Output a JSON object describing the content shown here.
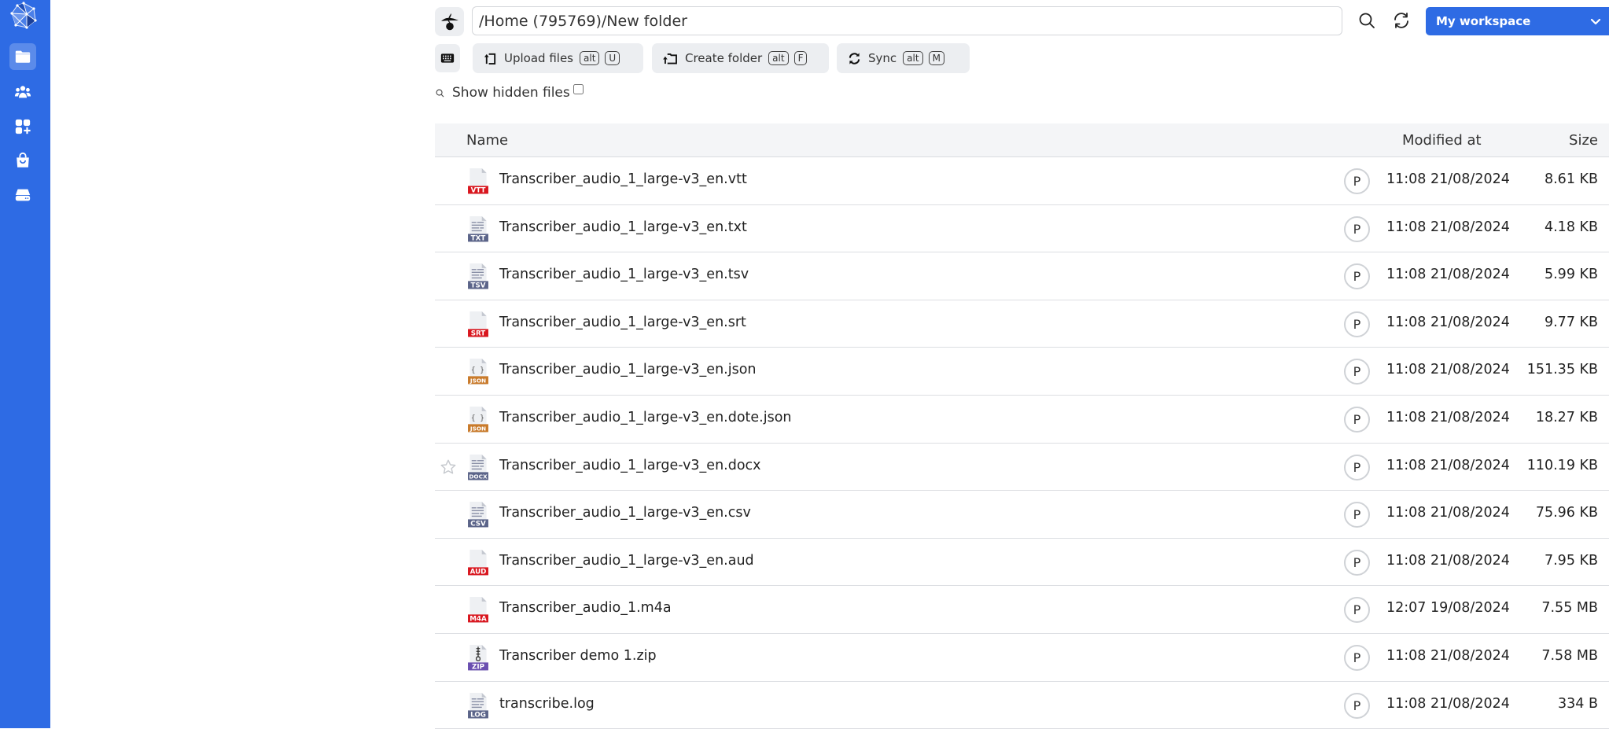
{
  "sidebar": {
    "logo": "polyhedron-logo",
    "items": [
      {
        "name": "files",
        "icon": "folder-icon",
        "active": true
      },
      {
        "name": "users",
        "icon": "users-icon",
        "active": false
      },
      {
        "name": "apps",
        "icon": "apps-add-icon",
        "active": false
      },
      {
        "name": "store",
        "icon": "shopping-bag-icon",
        "active": false
      },
      {
        "name": "storage",
        "icon": "drive-icon",
        "active": false
      }
    ]
  },
  "topbar": {
    "path": "/Home (795769)/New folder",
    "workspace_label": "My workspace",
    "accent": "#2e6be4"
  },
  "toolbar": {
    "upload": {
      "label": "Upload files",
      "keys": [
        "alt",
        "U"
      ]
    },
    "create": {
      "label": "Create folder",
      "keys": [
        "alt",
        "F"
      ]
    },
    "sync": {
      "label": "Sync",
      "keys": [
        "alt",
        "M"
      ]
    }
  },
  "filters": {
    "show_hidden_label": "Show hidden files",
    "show_hidden_checked": false
  },
  "table": {
    "columns": {
      "name": "Name",
      "modified": "Modified at",
      "size": "Size"
    },
    "rows": [
      {
        "name": "Transcriber_audio_1_large-v3_en.vtt",
        "type": "VTT",
        "color": "#d9161e",
        "style": "blank",
        "owner": "P",
        "modified": "11:08 21/08/2024",
        "size": "8.61 KB"
      },
      {
        "name": "Transcriber_audio_1_large-v3_en.txt",
        "type": "TXT",
        "color": "#5b6489",
        "style": "lines",
        "owner": "P",
        "modified": "11:08 21/08/2024",
        "size": "4.18 KB"
      },
      {
        "name": "Transcriber_audio_1_large-v3_en.tsv",
        "type": "TSV",
        "color": "#5b6489",
        "style": "lines",
        "owner": "P",
        "modified": "11:08 21/08/2024",
        "size": "5.99 KB"
      },
      {
        "name": "Transcriber_audio_1_large-v3_en.srt",
        "type": "SRT",
        "color": "#d9161e",
        "style": "blank",
        "owner": "P",
        "modified": "11:08 21/08/2024",
        "size": "9.77 KB"
      },
      {
        "name": "Transcriber_audio_1_large-v3_en.json",
        "type": "JSON",
        "color": "#c97a2a",
        "style": "braces",
        "owner": "P",
        "modified": "11:08 21/08/2024",
        "size": "151.35 KB"
      },
      {
        "name": "Transcriber_audio_1_large-v3_en.dote.json",
        "type": "JSON",
        "color": "#c97a2a",
        "style": "braces",
        "owner": "P",
        "modified": "11:08 21/08/2024",
        "size": "18.27 KB"
      },
      {
        "name": "Transcriber_audio_1_large-v3_en.docx",
        "type": "DOCX",
        "color": "#5b6489",
        "style": "lines",
        "owner": "P",
        "modified": "11:08 21/08/2024",
        "size": "110.19 KB",
        "star": true
      },
      {
        "name": "Transcriber_audio_1_large-v3_en.csv",
        "type": "CSV",
        "color": "#5b6489",
        "style": "lines",
        "owner": "P",
        "modified": "11:08 21/08/2024",
        "size": "75.96 KB"
      },
      {
        "name": "Transcriber_audio_1_large-v3_en.aud",
        "type": "AUD",
        "color": "#d9161e",
        "style": "blank",
        "owner": "P",
        "modified": "11:08 21/08/2024",
        "size": "7.95 KB"
      },
      {
        "name": "Transcriber_audio_1.m4a",
        "type": "M4A",
        "color": "#d9161e",
        "style": "blank",
        "owner": "P",
        "modified": "12:07 19/08/2024",
        "size": "7.55 MB"
      },
      {
        "name": "Transcriber demo 1.zip",
        "type": "ZIP",
        "color": "#6a4fb0",
        "style": "zip",
        "owner": "P",
        "modified": "11:08 21/08/2024",
        "size": "7.58 MB"
      },
      {
        "name": "transcribe.log",
        "type": "LOG",
        "color": "#5b6489",
        "style": "lines",
        "owner": "P",
        "modified": "11:08 21/08/2024",
        "size": "334 B"
      }
    ]
  }
}
